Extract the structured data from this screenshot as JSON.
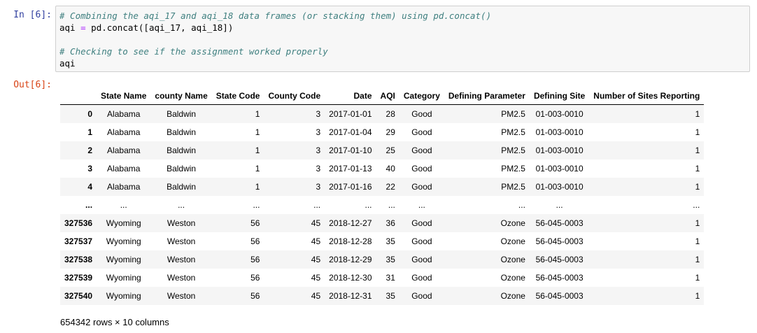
{
  "cell": {
    "in_prompt": "In [6]:",
    "out_prompt": "Out[6]:",
    "code": {
      "comment1": "# Combining the aqi_17 and aqi_18 data frames (or stacking them) using pd.concat()",
      "line2_lhs": "aqi ",
      "line2_op": "=",
      "line2_rhs": " pd.concat([aqi_17, aqi_18])",
      "comment2": "# Checking to see if the assignment worked properly",
      "line5": "aqi"
    }
  },
  "table": {
    "columns": [
      "State Name",
      "county Name",
      "State Code",
      "County Code",
      "Date",
      "AQI",
      "Category",
      "Defining Parameter",
      "Defining Site",
      "Number of Sites Reporting"
    ],
    "rows": [
      {
        "index": "0",
        "cells": [
          "Alabama",
          "Baldwin",
          "1",
          "3",
          "2017-01-01",
          "28",
          "Good",
          "PM2.5",
          "01-003-0010",
          "1"
        ]
      },
      {
        "index": "1",
        "cells": [
          "Alabama",
          "Baldwin",
          "1",
          "3",
          "2017-01-04",
          "29",
          "Good",
          "PM2.5",
          "01-003-0010",
          "1"
        ]
      },
      {
        "index": "2",
        "cells": [
          "Alabama",
          "Baldwin",
          "1",
          "3",
          "2017-01-10",
          "25",
          "Good",
          "PM2.5",
          "01-003-0010",
          "1"
        ]
      },
      {
        "index": "3",
        "cells": [
          "Alabama",
          "Baldwin",
          "1",
          "3",
          "2017-01-13",
          "40",
          "Good",
          "PM2.5",
          "01-003-0010",
          "1"
        ]
      },
      {
        "index": "4",
        "cells": [
          "Alabama",
          "Baldwin",
          "1",
          "3",
          "2017-01-16",
          "22",
          "Good",
          "PM2.5",
          "01-003-0010",
          "1"
        ]
      },
      {
        "index": "...",
        "cells": [
          "...",
          "...",
          "...",
          "...",
          "...",
          "...",
          "...",
          "...",
          "...",
          "..."
        ]
      },
      {
        "index": "327536",
        "cells": [
          "Wyoming",
          "Weston",
          "56",
          "45",
          "2018-12-27",
          "36",
          "Good",
          "Ozone",
          "56-045-0003",
          "1"
        ]
      },
      {
        "index": "327537",
        "cells": [
          "Wyoming",
          "Weston",
          "56",
          "45",
          "2018-12-28",
          "35",
          "Good",
          "Ozone",
          "56-045-0003",
          "1"
        ]
      },
      {
        "index": "327538",
        "cells": [
          "Wyoming",
          "Weston",
          "56",
          "45",
          "2018-12-29",
          "35",
          "Good",
          "Ozone",
          "56-045-0003",
          "1"
        ]
      },
      {
        "index": "327539",
        "cells": [
          "Wyoming",
          "Weston",
          "56",
          "45",
          "2018-12-30",
          "31",
          "Good",
          "Ozone",
          "56-045-0003",
          "1"
        ]
      },
      {
        "index": "327540",
        "cells": [
          "Wyoming",
          "Weston",
          "56",
          "45",
          "2018-12-31",
          "35",
          "Good",
          "Ozone",
          "56-045-0003",
          "1"
        ]
      }
    ],
    "shape_text": "654342 rows × 10 columns"
  }
}
